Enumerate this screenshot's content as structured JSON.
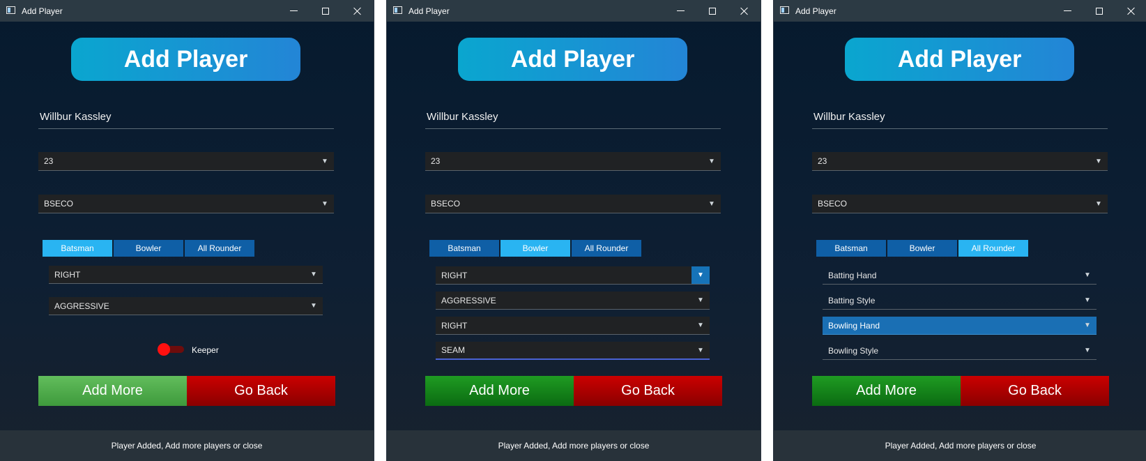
{
  "windows": [
    {
      "title": "Add Player",
      "header": "Add Player",
      "name_value": "Willbur Kassley",
      "age_value": "23",
      "course_value": "BSECO",
      "tabs": [
        "Batsman",
        "Bowler",
        "All Rounder"
      ],
      "selected_tab": "Batsman",
      "options": [
        {
          "value": "RIGHT",
          "state": "normal"
        },
        {
          "value": "AGGRESSIVE",
          "state": "normal"
        }
      ],
      "keeper_label": "Keeper",
      "keeper_on": true,
      "add_more": "Add More",
      "go_back": "Go Back",
      "status": "Player Added, Add more players or close"
    },
    {
      "title": "Add Player",
      "header": "Add Player",
      "name_value": "Willbur Kassley",
      "age_value": "23",
      "course_value": "BSECO",
      "tabs": [
        "Batsman",
        "Bowler",
        "All Rounder"
      ],
      "selected_tab": "Bowler",
      "options": [
        {
          "value": "RIGHT",
          "state": "hover"
        },
        {
          "value": "AGGRESSIVE",
          "state": "normal"
        },
        {
          "value": "RIGHT",
          "state": "normal"
        },
        {
          "value": "SEAM",
          "state": "focused"
        }
      ],
      "add_more": "Add More",
      "go_back": "Go Back",
      "status": "Player Added, Add more players or close"
    },
    {
      "title": "Add Player",
      "header": "Add Player",
      "name_value": "Willbur Kassley",
      "age_value": "23",
      "course_value": "BSECO",
      "tabs": [
        "Batsman",
        "Bowler",
        "All Rounder"
      ],
      "selected_tab": "All Rounder",
      "options": [
        {
          "value": "Batting Hand",
          "state": "flat"
        },
        {
          "value": "Batting Style",
          "state": "flat"
        },
        {
          "value": "Bowling Hand",
          "state": "highlight"
        },
        {
          "value": "Bowling Style",
          "state": "flat"
        }
      ],
      "add_more": "Add More",
      "go_back": "Go Back",
      "status": "Player Added, Add more players or close"
    }
  ],
  "colors": {
    "header_gradient_start": "#0aa6cf",
    "header_gradient_end": "#2385d6",
    "tab_selected": "#29b4f2",
    "tab_normal": "#0f5fa6",
    "add_more_green": "#1f9b22",
    "go_back_red": "#cb0000",
    "keeper_toggle": "#ff1010"
  }
}
